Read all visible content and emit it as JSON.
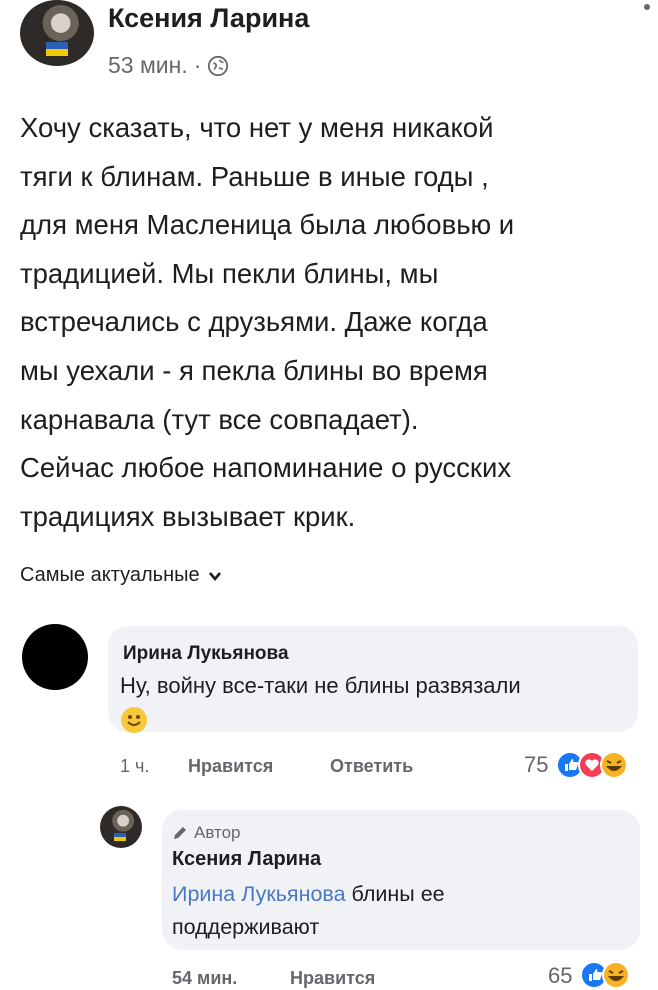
{
  "post": {
    "author": "Ксения Ларина",
    "time": "53 мин.",
    "separator": "·",
    "lines": [
      "Хочу сказать, что нет у меня никакой",
      "тяги к блинам. Раньше в иные годы ,",
      "для меня Масленица была любовью и",
      "традицией.  Мы пекли блины, мы",
      "встречались с друзьями. Даже когда",
      "мы уехали - я пекла блины во время",
      "карнавала (тут все совпадает).",
      "Сейчас любое напоминание о русских",
      "традициях вызывает крик."
    ]
  },
  "sort": {
    "label": "Самые актуальные"
  },
  "comments": [
    {
      "author": "Ирина Лукьянова",
      "text": "Ну, войну все-таки не блины развязали",
      "time": "1 ч.",
      "like": "Нравится",
      "reply": "Ответить",
      "reaction_count": "75"
    },
    {
      "badge": "Автор",
      "author": "Ксения Ларина",
      "mention": "Ирина Лукьянова",
      "text_line1": " блины ее",
      "text_line2": "поддерживают",
      "time": "54 мин.",
      "like": "Нравится",
      "reaction_count": "65"
    }
  ],
  "colors": {
    "like_blue": "#1877f2",
    "love_red": "#f33e58",
    "haha_yellow": "#f7b125",
    "mention_blue": "#4a78c4"
  }
}
